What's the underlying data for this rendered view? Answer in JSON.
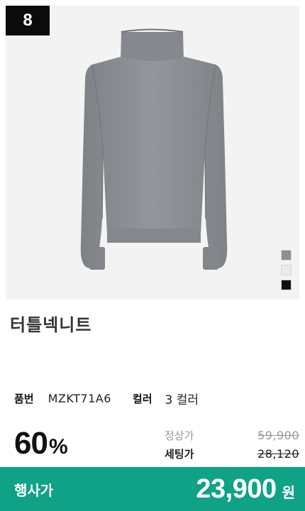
{
  "badge": {
    "rank": "8"
  },
  "product": {
    "image_icon": "turtleneck-sweater-image",
    "name": "터틀넥니트",
    "code_label": "품번",
    "code": "MZKT71A6",
    "color_label": "컬러",
    "color_count": "3 컬러",
    "swatches": [
      {
        "name": "gray",
        "color": "#8c8f93"
      },
      {
        "name": "ivory",
        "color": "#ecebe4"
      },
      {
        "name": "black",
        "color": "#111111"
      }
    ]
  },
  "pricing": {
    "discount_value": "60",
    "discount_unit": "%",
    "regular_label": "정상가",
    "regular_price": "59,900",
    "set_label": "세팅가",
    "set_price": "28,120"
  },
  "event": {
    "label": "행사가",
    "price": "23,900",
    "unit": "원",
    "color": "#0fa287"
  }
}
